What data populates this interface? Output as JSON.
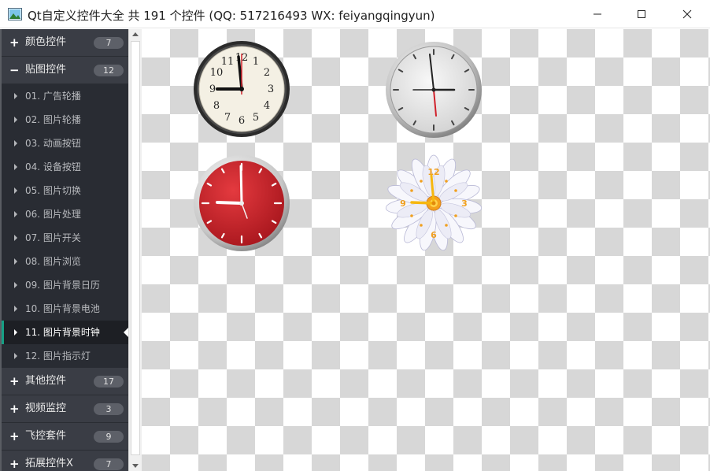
{
  "window": {
    "title": "Qt自定义控件大全 共 191 个控件 (QQ: 517216493 WX: feiyangqingyun)"
  },
  "sidebar": {
    "groups_top": [
      {
        "sign": "+",
        "label": "颜色控件",
        "count": "7"
      },
      {
        "sign": "−",
        "label": "贴图控件",
        "count": "12"
      }
    ],
    "items": [
      {
        "label": "01. 广告轮播"
      },
      {
        "label": "02. 图片轮播"
      },
      {
        "label": "03. 动画按钮"
      },
      {
        "label": "04. 设备按钮"
      },
      {
        "label": "05. 图片切换"
      },
      {
        "label": "06. 图片处理"
      },
      {
        "label": "07. 图片开关"
      },
      {
        "label": "08. 图片浏览"
      },
      {
        "label": "09. 图片背景日历"
      },
      {
        "label": "10. 图片背景电池"
      },
      {
        "label": "11. 图片背景时钟"
      },
      {
        "label": "12. 图片指示灯"
      }
    ],
    "active_item": "11. 图片背景时钟",
    "groups_bottom": [
      {
        "sign": "+",
        "label": "其他控件",
        "count": "17"
      },
      {
        "sign": "+",
        "label": "视频监控",
        "count": "3"
      },
      {
        "sign": "+",
        "label": "飞控套件",
        "count": "9"
      },
      {
        "sign": "+",
        "label": "拓展控件X",
        "count": "7"
      }
    ]
  },
  "clocks": {
    "black": {
      "numbers": [
        "12",
        "1",
        "2",
        "3",
        "4",
        "5",
        "6",
        "7",
        "8",
        "9",
        "10",
        "11"
      ]
    },
    "daisy": {
      "numbers": [
        "12",
        "3",
        "6",
        "9"
      ]
    }
  },
  "colors": {
    "sidebar_bg": "#292c33",
    "group_bg": "#3a3d45",
    "accent": "#16a085"
  },
  "icons": [
    "app-icon",
    "minimize-icon",
    "maximize-icon",
    "close-icon",
    "plus-icon",
    "minus-icon",
    "arrow-right-icon",
    "scroll-up-icon",
    "scroll-down-icon"
  ]
}
